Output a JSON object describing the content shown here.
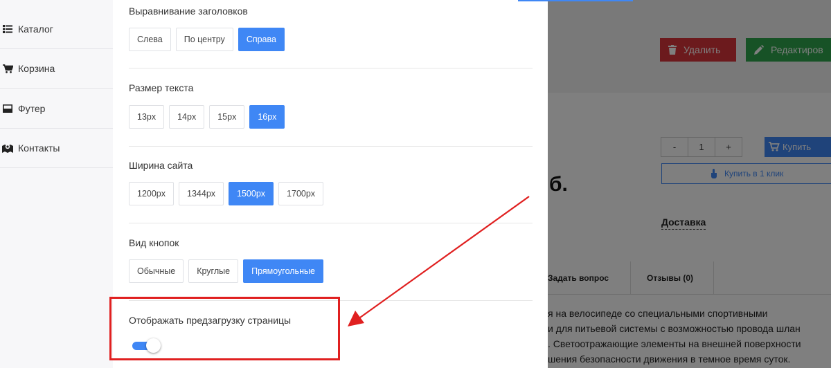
{
  "sidebar": {
    "items": [
      {
        "label": "Каталог",
        "icon": "list-icon"
      },
      {
        "label": "Корзина",
        "icon": "cart-icon"
      },
      {
        "label": "Футер",
        "icon": "footer-icon"
      },
      {
        "label": "Контакты",
        "icon": "map-marker-icon"
      }
    ]
  },
  "settings": {
    "heading_align": {
      "label": "Выравнивание заголовков",
      "options": [
        "Слева",
        "По центру",
        "Справа"
      ],
      "selected": "Справа"
    },
    "text_size": {
      "label": "Размер текста",
      "options": [
        "13px",
        "14px",
        "15px",
        "16px"
      ],
      "selected": "16px"
    },
    "site_width": {
      "label": "Ширина сайта",
      "options": [
        "1200px",
        "1344px",
        "1500px",
        "1700px"
      ],
      "selected": "1500px"
    },
    "button_style": {
      "label": "Вид кнопок",
      "options": [
        "Обычные",
        "Круглые",
        "Прямоугольные"
      ],
      "selected": "Прямоугольные"
    },
    "preloader": {
      "label": "Отображать предзагрузку страницы",
      "enabled": true
    }
  },
  "background_page": {
    "delete_label": "Удалить",
    "edit_label": "Редактиров",
    "qty_minus": "-",
    "qty_value": "1",
    "qty_plus": "+",
    "buy_label": "Купить",
    "one_click_label": "Купить в 1 клик",
    "price_fragment": "б.",
    "delivery_label": "Доставка",
    "tab_question": "Задать вопрос",
    "tab_reviews": "Отзывы (0)",
    "desc_lines": [
      "я на велосипеде со специальными спортивными",
      "и для питьевой системы с возможностью провода шлан",
      ". Светоотражающие элементы на внешней поверхности",
      "шения безопасности движения в темное время суток."
    ]
  },
  "colors": {
    "accent": "#3f87f5",
    "annotation": "#e02020",
    "delete": "#d9343a",
    "edit": "#2fa54c"
  }
}
